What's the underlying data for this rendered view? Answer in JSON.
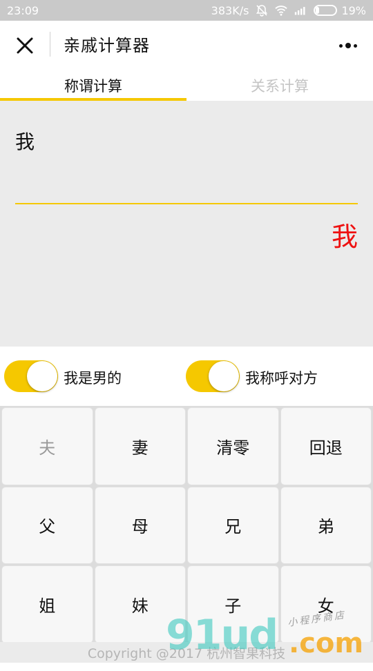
{
  "status_bar": {
    "time": "23:09",
    "network_speed": "383K/s",
    "battery_percent": "19%",
    "battery_level": 0.19
  },
  "header": {
    "title": "亲戚计算器",
    "close_icon": "close-icon",
    "more_icon": "more-icon"
  },
  "tabs": [
    {
      "label": "称谓计算",
      "active": true
    },
    {
      "label": "关系计算",
      "active": false
    }
  ],
  "display": {
    "input": "我",
    "result": "我"
  },
  "toggles": [
    {
      "label": "我是男的",
      "on": true
    },
    {
      "label": "我称呼对方",
      "on": true
    }
  ],
  "keypad": {
    "keys": [
      "夫",
      "妻",
      "清零",
      "回退",
      "父",
      "母",
      "兄",
      "弟",
      "姐",
      "妹",
      "子",
      "女"
    ],
    "disabled": [
      "夫"
    ]
  },
  "footer": {
    "text": "Copyright @2017 杭州智果科技"
  },
  "watermark": {
    "main": "91ud",
    "com": ".com",
    "sub": "小程序商店"
  },
  "colors": {
    "accent": "#f5c800",
    "result": "#ee1111",
    "panel": "#ebebeb",
    "status_bar": "#c9c9c9"
  }
}
